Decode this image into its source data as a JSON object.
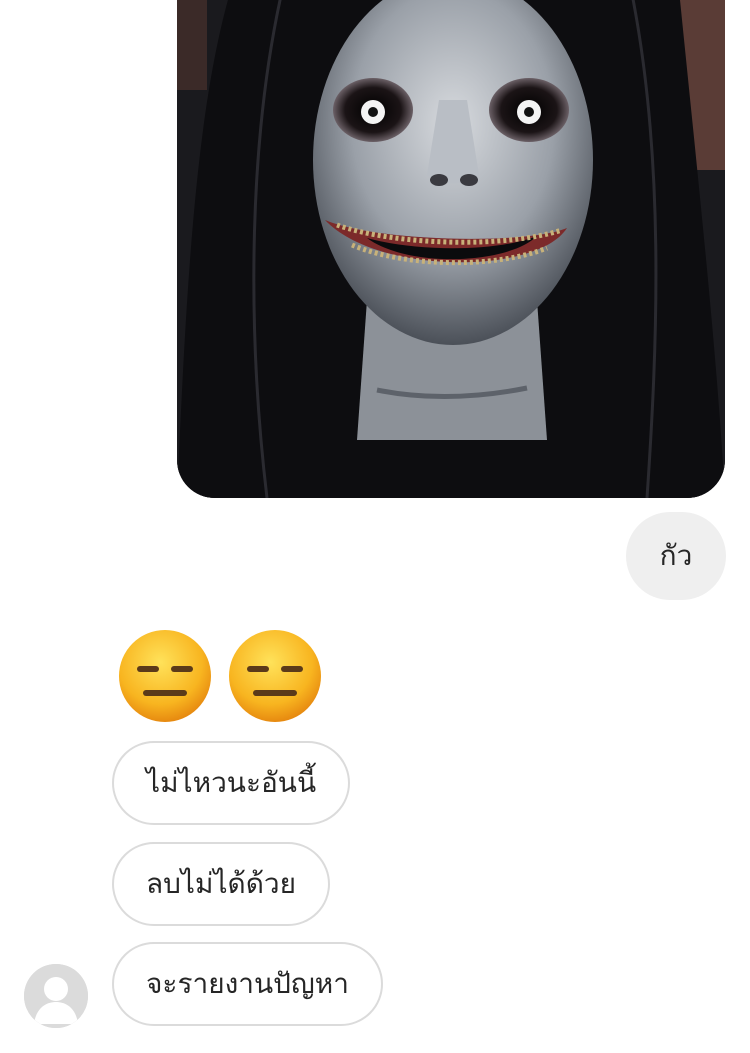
{
  "conversation": {
    "shared_photo": {
      "description_icon": "horror-face-photo"
    },
    "sent_message": "กัว",
    "received": {
      "emojis": [
        "😑",
        "😑"
      ],
      "messages": [
        "ไม่ไหวนะอันนี้",
        "ลบไม่ได้ด้วย",
        "จะรายงานปัญหา"
      ]
    },
    "avatar_icon": "default-user-avatar-icon"
  }
}
